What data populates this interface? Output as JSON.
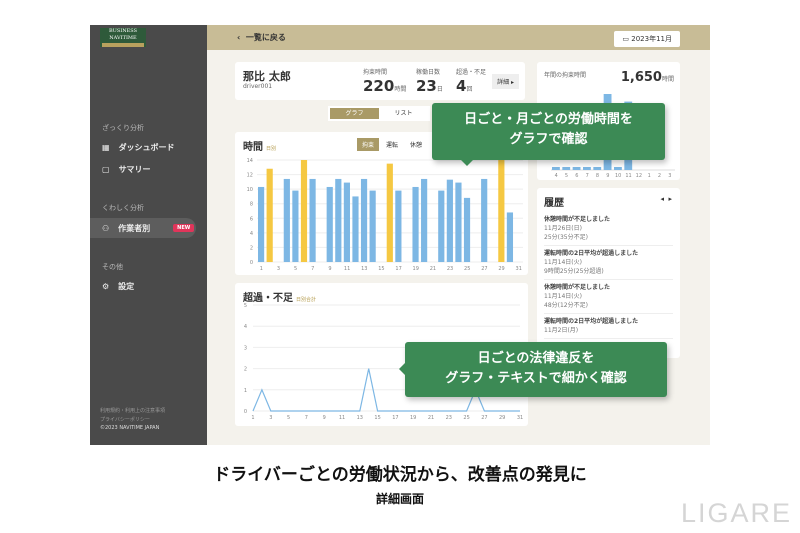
{
  "sidebar": {
    "logo": "BUSINESS NAVITIME",
    "sections": [
      {
        "label": "ざっくり分析"
      },
      {
        "label": "くわしく分析"
      },
      {
        "label": "その他"
      }
    ],
    "items": [
      {
        "label": "ダッシュボード"
      },
      {
        "label": "サマリー"
      },
      {
        "label": "作業者別",
        "badge": "NEW"
      },
      {
        "label": "設定"
      }
    ],
    "footer": [
      "利用規約・利用上の注意事項",
      "プライバシーポリシー",
      "©2023 NAVITIME JAPAN"
    ]
  },
  "header": {
    "back": "一覧に戻る",
    "date": "2023年11月"
  },
  "profile": {
    "name": "那比 太郎",
    "id": "driver001",
    "stats": [
      {
        "label": "拘束時間",
        "value": "220",
        "unit": "時間"
      },
      {
        "label": "稼働日数",
        "value": "23",
        "unit": "日"
      },
      {
        "label": "超過・不足",
        "value": "4",
        "unit": "回"
      }
    ],
    "detail": "詳細 ▸"
  },
  "view_toggle": [
    "グラフ",
    "リスト"
  ],
  "hours_chart": {
    "title": "時間",
    "sub": "日別",
    "tabs": [
      "拘束",
      "運転",
      "休憩"
    ]
  },
  "over_chart": {
    "title": "超過・不足",
    "sub": "日別合計"
  },
  "annual": {
    "title": "年間の拘束時間",
    "value": "1,650",
    "unit": "時間"
  },
  "history": {
    "title": "履歴",
    "items": [
      {
        "title": "休憩時間が不足しました",
        "date": "11月26日(日)",
        "detail": "25分(35分不足)"
      },
      {
        "title": "運転時間の2日平均が超過しました",
        "date": "11月14日(火)",
        "detail": "9時間25分(25分超過)"
      },
      {
        "title": "休憩時間が不足しました",
        "date": "11月14日(火)",
        "detail": "48分(12分不足)"
      },
      {
        "title": "運転時間の2日平均が超過しました",
        "date": "11月2日(月)",
        "detail": ""
      }
    ]
  },
  "callouts": [
    "日ごと・月ごとの労働時間を",
    "グラフで確認",
    "日ごとの法律違反を",
    "グラフ・テキストで細かく確認"
  ],
  "caption": {
    "main": "ドライバーごとの労働状況から、改善点の発見に",
    "sub": "詳細画面"
  },
  "brand": "LIGARE",
  "chart_data": [
    {
      "type": "bar",
      "title": "時間",
      "ylim": [
        0,
        14
      ],
      "yticks": [
        0,
        2,
        4,
        6,
        8,
        10,
        12,
        14
      ],
      "xticks": [
        "1",
        "3",
        "5",
        "7",
        "9",
        "11",
        "13",
        "15",
        "17",
        "19",
        "21",
        "23",
        "25",
        "27",
        "29",
        "31"
      ],
      "ylabel_unit": "時間",
      "xlabel_unit": "日",
      "days": [
        1,
        2,
        3,
        4,
        5,
        6,
        7,
        8,
        9,
        10,
        11,
        12,
        13,
        14,
        15,
        16,
        17,
        18,
        19,
        20,
        21,
        22,
        23,
        24,
        25,
        26,
        27,
        28,
        29,
        30,
        31
      ],
      "values": [
        10.3,
        12.8,
        0,
        11.4,
        9.8,
        14,
        11.4,
        0,
        10.3,
        11.4,
        10.9,
        9,
        11.4,
        9.8,
        0,
        13.5,
        9.8,
        0,
        10.3,
        11.4,
        0,
        9.8,
        11.3,
        10.9,
        8.8,
        0,
        11.4,
        0,
        14,
        6.8,
        0
      ],
      "over_limit": [
        false,
        true,
        false,
        false,
        false,
        true,
        false,
        false,
        false,
        false,
        false,
        false,
        false,
        false,
        false,
        true,
        false,
        false,
        false,
        false,
        false,
        false,
        false,
        false,
        false,
        false,
        false,
        false,
        true,
        false,
        false
      ],
      "colors": {
        "normal": "#7db7e4",
        "over": "#f5c842"
      }
    },
    {
      "type": "line",
      "title": "超過・不足",
      "ylim": [
        0,
        5
      ],
      "yticks": [
        0,
        1,
        2,
        3,
        4,
        5
      ],
      "xticks": [
        "1",
        "3",
        "5",
        "7",
        "9",
        "11",
        "13",
        "15",
        "17",
        "19",
        "21",
        "23",
        "25",
        "27",
        "29",
        "31"
      ],
      "values": [
        0,
        1,
        0,
        0,
        0,
        0,
        0,
        0,
        0,
        0,
        0,
        0,
        0,
        2,
        0,
        0,
        0,
        0,
        0,
        0,
        0,
        0,
        0,
        0,
        0,
        1,
        0,
        0,
        0,
        0,
        0
      ],
      "color": "#7db7e4"
    },
    {
      "type": "bar",
      "title": "年間の拘束時間",
      "ylim": [
        0,
        10
      ],
      "categories": [
        "4",
        "5",
        "6",
        "7",
        "8",
        "9",
        "10",
        "11",
        "12",
        "1",
        "2",
        "3"
      ],
      "values": [
        1,
        1,
        1,
        1,
        1,
        10,
        1,
        9,
        0,
        0,
        0,
        0
      ],
      "color": "#7db7e4"
    }
  ]
}
